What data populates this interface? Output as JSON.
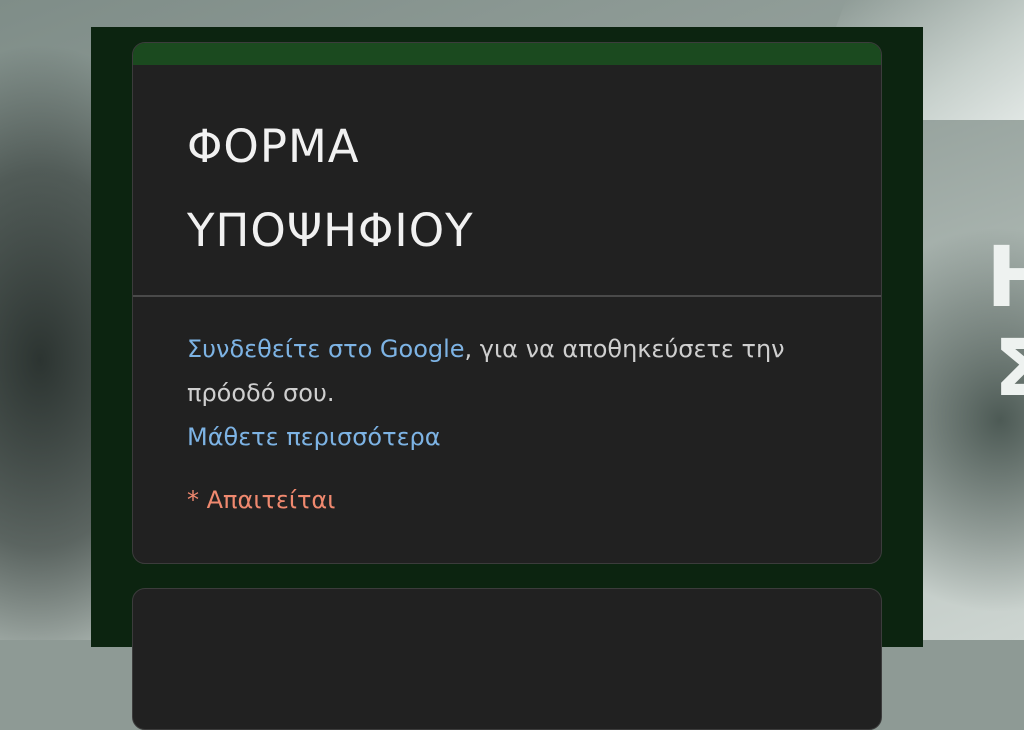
{
  "form": {
    "title_line1": "ΦΟΡΜΑ",
    "title_line2": "ΥΠΟΨΗΦΙΟΥ",
    "signin_link": "Συνδεθείτε στο Google",
    "signin_rest": ", για να αποθηκεύσετε την πρόοδό σου.",
    "learn_more": "Μάθετε περισσότερα",
    "required_note": "* Απαιτείται"
  },
  "colors": {
    "accent_bar": "#1b4a1f",
    "card_background": "#212121",
    "link": "#7db3e4",
    "required": "#f0896f",
    "frame": "#0c2410"
  }
}
